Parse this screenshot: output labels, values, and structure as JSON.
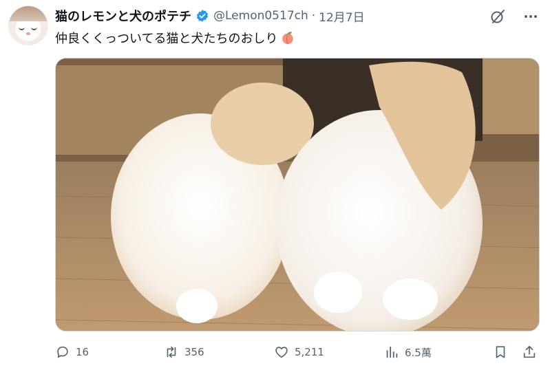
{
  "author": {
    "display_name": "猫のレモンと犬のポテチ",
    "handle": "@Lemon0517ch",
    "separator": "·",
    "date": "12月7日",
    "verified": true,
    "avatar": "cat-avatar"
  },
  "post": {
    "text": "仲良くくっついてる猫と犬たちのおしり",
    "emoji": "peach-emoji"
  },
  "media": {
    "kind": "photo",
    "subject": "cat-and-dog-fluffy-rears"
  },
  "actions": {
    "replies": "16",
    "reposts": "356",
    "likes": "5,211",
    "views": "6.5萬"
  },
  "icons": {
    "grok": "grok-icon",
    "more": "more-dots-icon",
    "reply": "reply-icon",
    "repost": "repost-icon",
    "like": "heart-icon",
    "views": "analytics-icon",
    "bookmark": "bookmark-icon",
    "share": "share-icon"
  },
  "colors": {
    "text_primary": "#0f1419",
    "text_secondary": "#536471",
    "verified_blue": "#1d9bf0"
  }
}
